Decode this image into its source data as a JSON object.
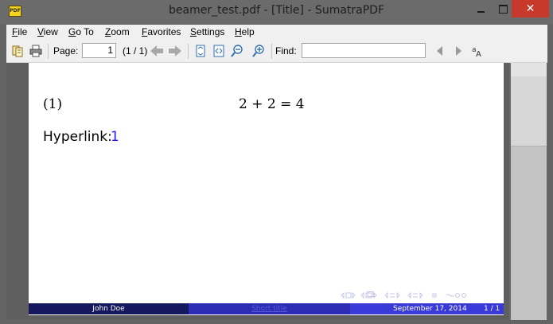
{
  "window": {
    "title": "beamer_test.pdf - [Title] - SumatraPDF",
    "app_icon_text": "PDF",
    "minimize": "",
    "maximize": "",
    "close": "✕"
  },
  "menu": {
    "items": [
      {
        "first": "F",
        "rest": "ile"
      },
      {
        "first": "V",
        "rest": "iew"
      },
      {
        "first": "G",
        "rest": "o To"
      },
      {
        "first": "Z",
        "rest": "oom"
      },
      {
        "first": "F",
        "rest": "avorites"
      },
      {
        "first": "S",
        "rest": "ettings"
      },
      {
        "first": "H",
        "rest": "elp"
      }
    ]
  },
  "toolbar": {
    "page_label": "Page:",
    "page_value": "1",
    "page_total": "(1 / 1)",
    "find_label": "Find:",
    "find_value": ""
  },
  "document": {
    "equation_number": "(1)",
    "equation": "2 + 2 = 4",
    "hyperlink_label": "Hyperlink:",
    "hyperlink_target": "1",
    "footer": {
      "author": "John Doe",
      "short_title": "Short title",
      "date": "September 17, 2014",
      "page": "1 / 1"
    }
  },
  "colors": {
    "footer_author_bg": "#16185e",
    "footer_title_bg": "#2c2cb4",
    "footer_date_bg": "#3a3ad8",
    "hyperlink": "#1c1cff"
  }
}
